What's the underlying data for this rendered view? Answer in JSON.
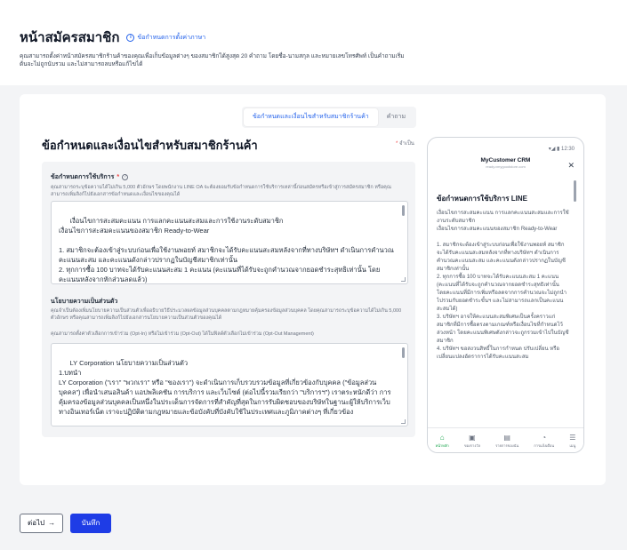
{
  "header": {
    "title": "หน้าสมัครสมาชิก",
    "help_link": "ข้อกำหนดการตั้งค่าภาษา",
    "description": "คุณสามารถตั้งค่าหน้าสมัครสมาชิกร้านค้าของคุณเพื่อเก็บข้อมูลต่างๆ ของสมาชิกได้สูงสุด 20 คำถาม โดยชื่อ-นามสกุล และหมายเลขโทรศัพท์ เป็นคำถามเริ่มต้นจะไม่ถูกนับรวม และไม่สามารถลบหรือแก้ไขได้"
  },
  "tabs": [
    {
      "label": "ข้อกำหนดและเงื่อนไขสำหรับสมาชิกร้านค้า"
    },
    {
      "label": "คำถาม"
    }
  ],
  "section": {
    "title": "ข้อกำหนดและเงื่อนไขสำหรับสมาชิกร้านค้า",
    "required_note": "จำเป็น"
  },
  "terms_field": {
    "label": "ข้อกำหนดการใช้บริการ",
    "description": "คุณสามารถระบุข้อความได้ไม่เกิน 5,000 ตัวอักษร โดยพนักงาน LINE OA จะต้องยอมรับข้อกำหนดการใช้บริการเหล่านี้ก่อนสมัครหรือเข้าสู่การสมัครสมาชิก หรือคุณสามารถเพิ่มลิงก์ไปยังเอกสารข้อกำหนดและเงื่อนไขของคุณได้",
    "value": "เงื่อนไขการสะสมคะแนน การแลกคะแนนสะสมและการใช้งานระดับสมาชิก\nเงื่อนไขการสะสมคะแนนของสมาชิก Ready-to-Wear\n\n1. สมาชิกจะต้องเข้าสู่ระบบก่อนเพื่อใช้งานพอยท์ สมาชิกจะได้รับคะแนนสะสมหลังจากที่ทางบริษัทฯ ดำเนินการคำนวณคะแนนสะสม และคะแนนดังกล่าวปรากฏในบัญชีสมาชิกเท่านั้น\n2. ทุกการซื้อ 100 บาทจะได้รับคะแนนสะสม 1 คะแนน (คะแนนที่ได้รับจะถูกคำนวณจากยอดชำระสุทธิเท่านั้น โดยคะแนนหลังจากหักส่วนลดแล้ว)"
  },
  "privacy_field": {
    "label": "นโยบายความเป็นส่วนตัว",
    "description": "คุณจำเป็นต้องเพิ่มนโยบายความเป็นส่วนตัวเพื่ออธิบายวิธีประมวลผลข้อมูลส่วนบุคคลตามกฎหมายคุ้มครองข้อมูลส่วนบุคคล โดยคุณสามารถระบุข้อความได้ไม่เกิน 5,000 ตัวอักษร หรือคุณสามารถเพิ่มลิงก์ไปยังเอกสารนโยบายความเป็นส่วนตัวของคุณได้",
    "opt_note": "คุณสามารถตั้งค่าตัวเลือกการเข้าร่วม (Opt-In) หรือไม่เข้าร่วม (Opt-Out) ได้ในฟิลด์ตัวเลือกไม่เข้าร่วม (Opt-Out Management)",
    "value": "LY Corporation นโยบายความเป็นส่วนตัว\n1.บทนำ\nLY Corporation (\"เรา\" \"พวกเรา\" หรือ \"ของเรา\") จะดำเนินการเก็บรวบรวมข้อมูลที่เกี่ยวข้องกับบุคคล (\"ข้อมูลส่วนบุคคล\") เพื่อนำเสนอสินค้า แอปพลิเคชัน การบริการ และเว็บไซต์ (ต่อไปนี้รวมเรียกว่า \"บริการฯ\") เราตระหนักดีว่า การคุ้มครองข้อมูลส่วนบุคคลเป็นหนึ่งในประเด็นการจัดการที่สำคัญที่สุดในการรับผิดชอบของบริษัทในฐานะผู้ให้บริการเว็บทางอินเทอร์เน็ต เราจะปฏิบัติตามกฎหมายและข้อบังคับที่บังคับใช้ในประเทศและภูมิภาคต่างๆ ที่เกี่ยวข้อง"
  },
  "preview": {
    "status_time": "12:30",
    "app_title": "MyCustomer CRM",
    "app_subtitle": "ready.vmygoodstore.com",
    "terms_title": "ข้อกำหนดการใช้บริการ LINE",
    "text": "เงื่อนไขการสะสมคะแนน การแลกคะแนนสะสมและการใช้งานระดับสมาชิก\nเงื่อนไขการสะสมคะแนนของสมาชิก Ready-to-Wear\n\n1. สมาชิกจะต้องเข้าสู่ระบบก่อนเพื่อใช้งานพอยท์ สมาชิกจะได้รับคะแนนสะสมหลังจากที่ทางบริษัทฯ ดำเนินการคำนวณคะแนนสะสม และคะแนนดังกล่าวปรากฏในบัญชีสมาชิกเท่านั้น\n2. ทุกการซื้อ 100 บาทจะได้รับคะแนนสะสม 1 คะแนน (คะแนนที่ได้รับจะถูกคำนวณจากยอดชำระสุทธิเท่านั้น โดยคะแนนที่มีการเพิ่มหรือลดจากการคำนวณจะไม่ถูกนำไปรวมกับยอดชำระขั้นฯ และไม่สามารถแลกเป็นคะแนนสะสมได้)\n3. บริษัทฯ อาจให้คะแนนสะสมพิเศษเป็นครั้งคราวแก่สมาชิกที่มีการซื้อตรงตามเกณฑ์หรือเงื่อนไขที่กำหนดไว้ล่วงหน้า โดยคะแนนพิเศษดังกล่าวจะถูกรวมเข้าไปในบัญชีสมาชิก\n4. บริษัทฯ ขอสงวนสิทธิ์ในการกำหนด ปรับเปลี่ยน หรือเปลี่ยนแปลงอัตราการได้รับคะแนนสะสม",
    "nav": [
      {
        "icon": "⌂",
        "label": "หน้าหลัก"
      },
      {
        "icon": "▣",
        "label": "ของรางวัล"
      },
      {
        "icon": "▤",
        "label": "รายการของฉัน"
      },
      {
        "icon": "◔",
        "label": "การแจ้งเตือน"
      },
      {
        "icon": "☰",
        "label": "เมนู"
      }
    ]
  },
  "footer": {
    "next_label": "ต่อไป",
    "save_label": "บันทึก"
  }
}
